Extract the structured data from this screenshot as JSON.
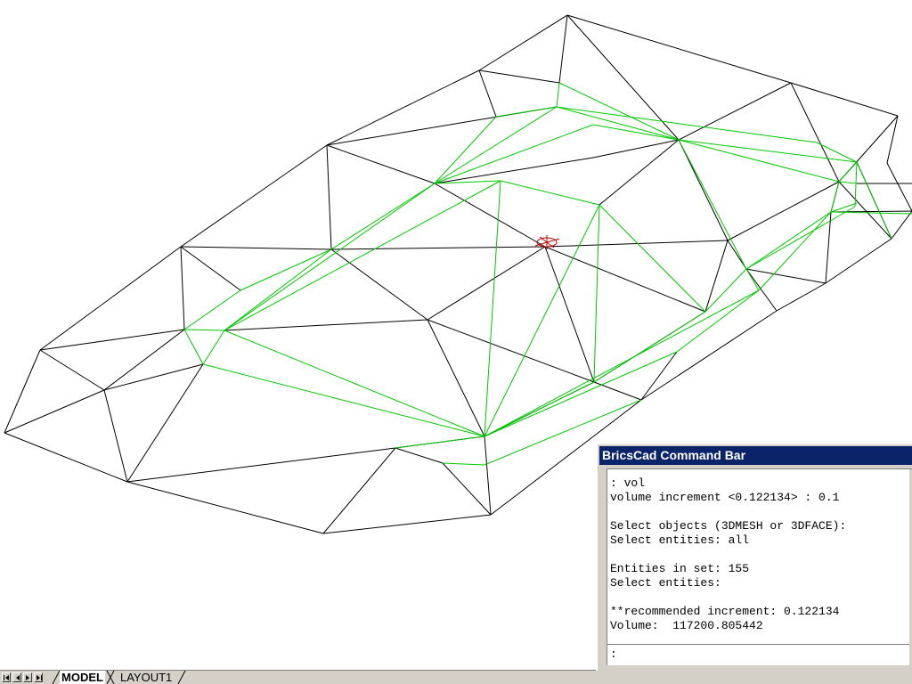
{
  "drawing": {
    "colors": {
      "mesh_edge": "#000000",
      "contour": "#00c800",
      "ucs_marker": "#c00000"
    }
  },
  "tabs": {
    "nav_buttons": [
      "first-tab",
      "previous-tab",
      "next-tab",
      "last-tab"
    ],
    "items": [
      {
        "label": "MODEL",
        "active": true
      },
      {
        "label": "LAYOUT1",
        "active": false
      }
    ]
  },
  "command_bar": {
    "title": "BricsCad Command Bar",
    "history": [
      ": vol",
      "volume increment <0.122134> : 0.1",
      "",
      "Select objects (3DMESH or 3DFACE):",
      "Select entities: all",
      "",
      "Entities in set: 155",
      "Select entities:",
      "",
      "**recommended increment: 0.122134",
      "Volume:  117200.805442"
    ],
    "prompt": ":"
  }
}
